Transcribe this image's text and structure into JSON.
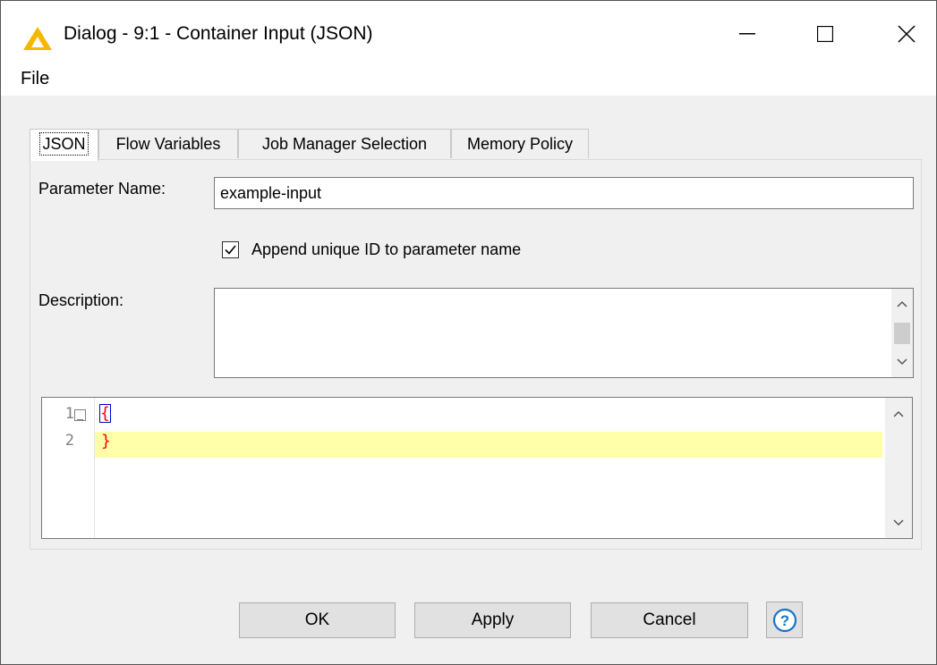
{
  "window": {
    "title": "Dialog - 9:1 - Container Input (JSON)",
    "accent_color": "#f5b800"
  },
  "menu": {
    "file_label": "File"
  },
  "tabs": [
    {
      "label": "JSON",
      "active": true
    },
    {
      "label": "Flow Variables",
      "active": false
    },
    {
      "label": "Job Manager Selection",
      "active": false
    },
    {
      "label": "Memory Policy",
      "active": false
    }
  ],
  "form": {
    "parameter_name_label": "Parameter Name:",
    "parameter_name_value": "example-input",
    "append_checkbox_label": "Append unique ID to parameter name",
    "append_checkbox_checked": true,
    "description_label": "Description:",
    "description_value": ""
  },
  "editor": {
    "lines": [
      {
        "number": "1",
        "text": "{"
      },
      {
        "number": "2",
        "text": "}"
      }
    ],
    "current_line_color": "#ffffaa",
    "bracket_color": "#ff0000"
  },
  "buttons": {
    "ok": "OK",
    "apply": "Apply",
    "cancel": "Cancel",
    "help": "?"
  }
}
